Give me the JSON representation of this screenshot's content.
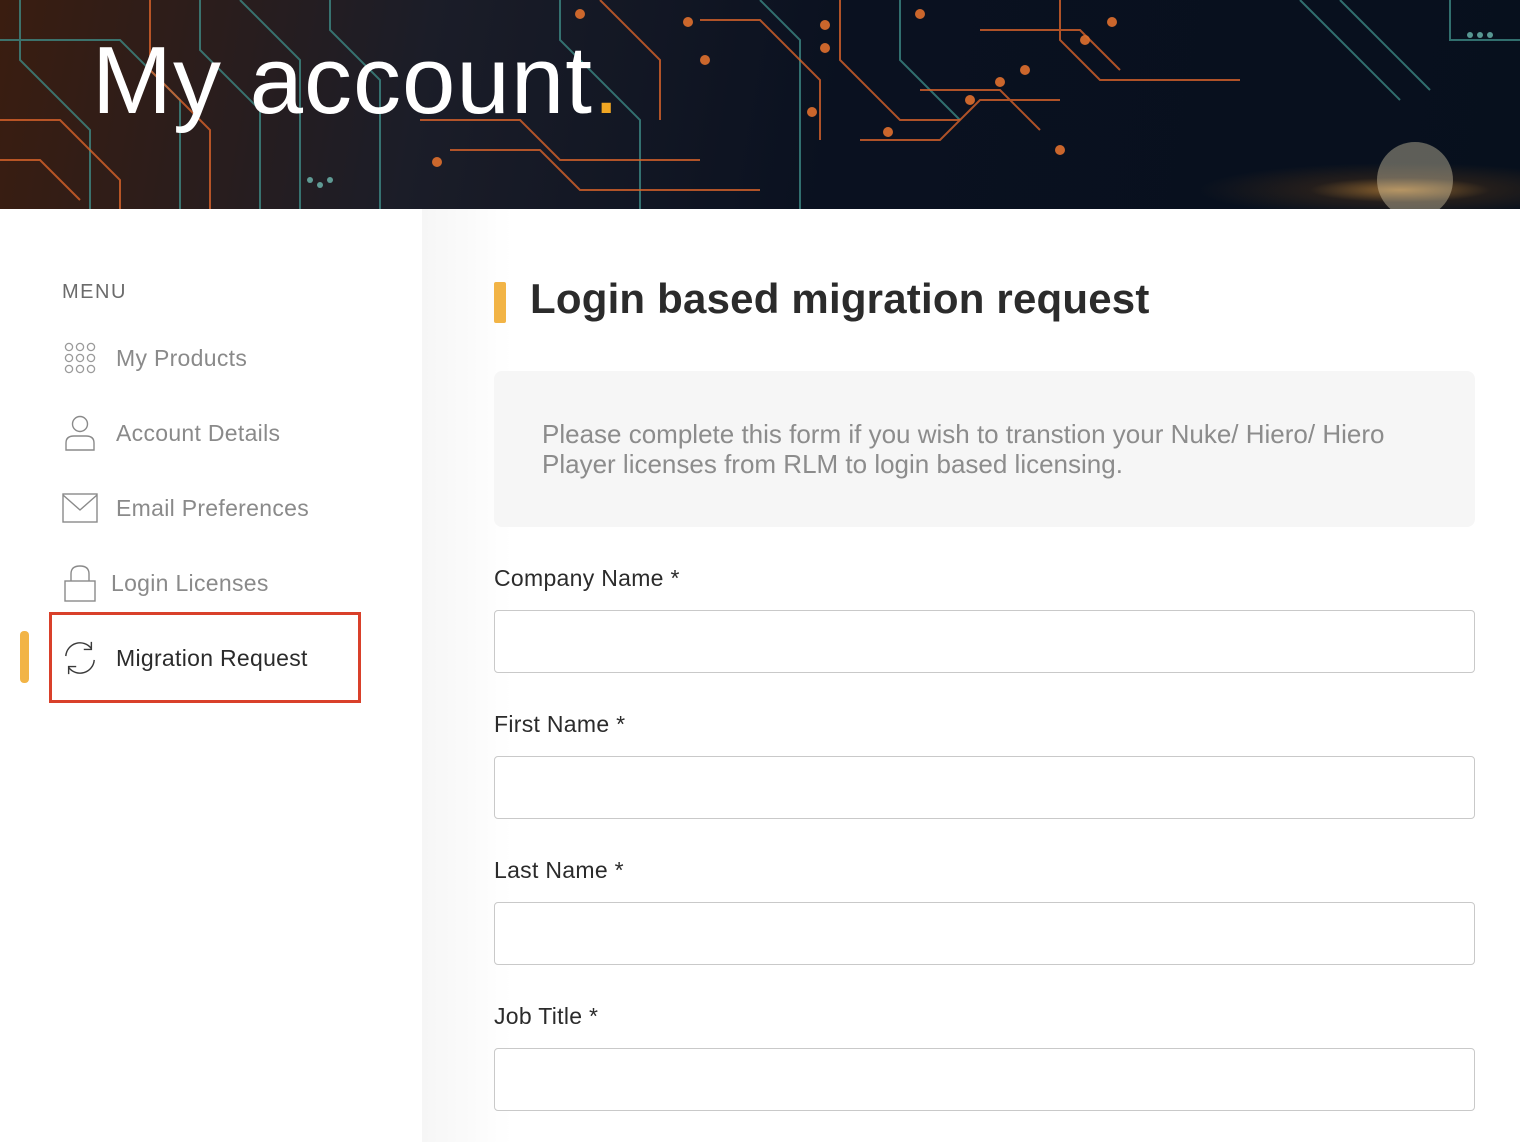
{
  "banner": {
    "title": "My account",
    "title_dot": "."
  },
  "sidebar": {
    "menu_heading": "MENU",
    "items": [
      {
        "label": "My Products",
        "icon": "grid-dots-icon",
        "active": false
      },
      {
        "label": "Account Details",
        "icon": "user-icon",
        "active": false
      },
      {
        "label": "Email Preferences",
        "icon": "envelope-icon",
        "active": false
      },
      {
        "label": "Login Licenses",
        "icon": "lock-icon",
        "active": false
      },
      {
        "label": "Migration Request",
        "icon": "refresh-icon",
        "active": true
      }
    ]
  },
  "main": {
    "title": "Login based migration request",
    "info": "Please complete this form if you wish to transtion your Nuke/ Hiero/ Hiero Player licenses from RLM to login based licensing.",
    "fields": [
      {
        "label": "Company Name *",
        "value": ""
      },
      {
        "label": "First Name *",
        "value": ""
      },
      {
        "label": "Last Name *",
        "value": ""
      },
      {
        "label": "Job Title *",
        "value": ""
      }
    ]
  },
  "colors": {
    "accent": "#f2b446",
    "highlight": "#d9402a",
    "text": "#2b2b2b",
    "muted": "#8a8a8a"
  }
}
